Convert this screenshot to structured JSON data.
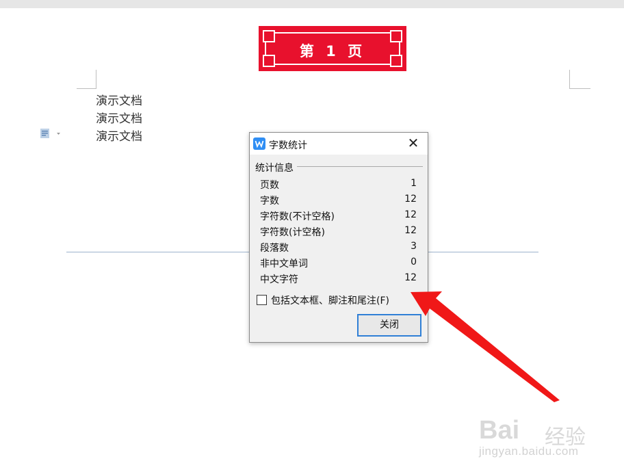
{
  "page_banner": {
    "label": "第 1 页"
  },
  "document": {
    "lines": [
      "演示文档",
      "演示文档",
      "演示文档"
    ]
  },
  "dialog": {
    "title": "字数统计",
    "group_label": "统计信息",
    "stats": [
      {
        "label": "页数",
        "value": "1"
      },
      {
        "label": "字数",
        "value": "12"
      },
      {
        "label": "字符数(不计空格)",
        "value": "12"
      },
      {
        "label": "字符数(计空格)",
        "value": "12"
      },
      {
        "label": "段落数",
        "value": "3"
      },
      {
        "label": "非中文单词",
        "value": "0"
      },
      {
        "label": "中文字符",
        "value": "12"
      }
    ],
    "checkbox_label": "包括文本框、脚注和尾注(F)",
    "checkbox_checked": false,
    "close_button": "关闭"
  },
  "icons": {
    "app": "wps-writer-icon",
    "close": "close-icon",
    "paragraph": "paragraph-options-icon"
  },
  "colors": {
    "banner": "#e8112d",
    "accent": "#2f7fd6",
    "arrow": "#f01818"
  },
  "watermark": {
    "brand": "Bai",
    "brand_cn": "经验",
    "url": "jingyan.baidu.com"
  }
}
